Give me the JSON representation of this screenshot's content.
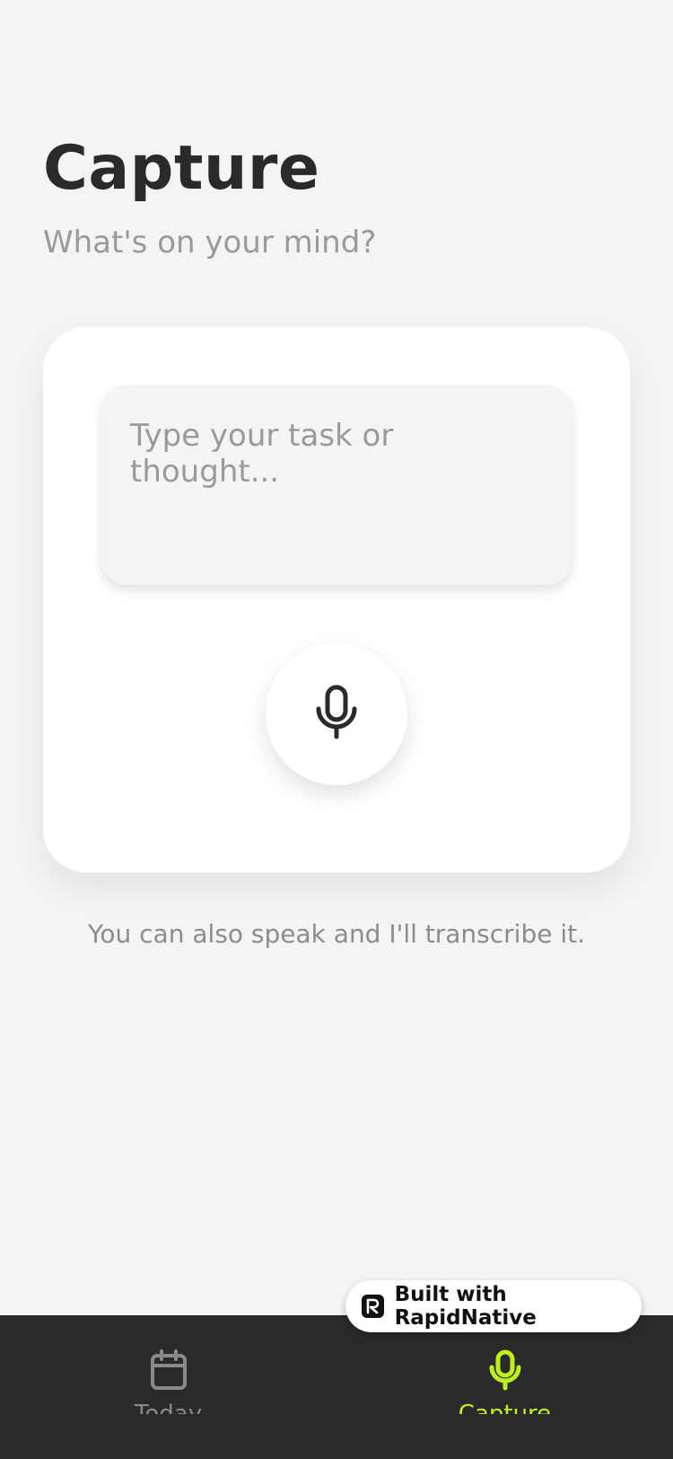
{
  "header": {
    "title": "Capture",
    "subtitle": "What's on your mind?"
  },
  "capture_card": {
    "input_placeholder": "Type your task or thought...",
    "input_value": "",
    "mic_icon": "microphone-icon"
  },
  "hint": "You can also speak and I'll transcribe it.",
  "tab_bar": {
    "tabs": [
      {
        "label": "Today",
        "icon": "calendar-icon",
        "active": false
      },
      {
        "label": "Capture",
        "icon": "microphone-icon",
        "active": true
      }
    ]
  },
  "badge": {
    "label": "Built with RapidNative",
    "icon": "rapidnative-logo-icon"
  },
  "colors": {
    "background": "#f4f4f2",
    "accent": "#bff01e",
    "tab_bar": "#2a2a2a",
    "text_primary": "#2a2a2a",
    "text_muted": "#9a9a9a"
  }
}
